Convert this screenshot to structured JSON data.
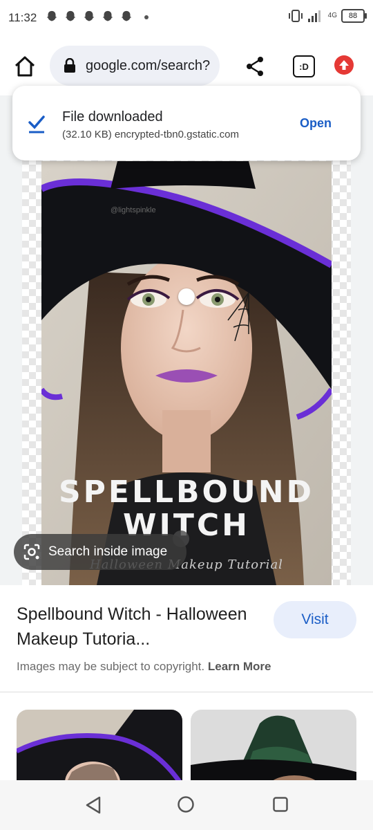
{
  "status_bar": {
    "time": "11:32",
    "notification_icons": [
      "snapchat-icon",
      "snapchat-icon",
      "snapchat-icon",
      "snapchat-icon",
      "snapchat-icon"
    ],
    "network": "4G",
    "battery": "88"
  },
  "toolbar": {
    "url": "google.com/search?",
    "tab_switcher_label": ":D",
    "icons": [
      "home-icon",
      "lock-icon",
      "share-icon",
      "tab-switcher-icon",
      "update-icon"
    ]
  },
  "download": {
    "title": "File downloaded",
    "subtitle": "(32.10 KB) encrypted-tbn0.gstatic.com",
    "action": "Open"
  },
  "image": {
    "title_line1": "SPELLBOUND",
    "title_line2": "WITCH",
    "subtitle": "Halloween Makeup Tutorial",
    "watermark": "@lightspinkle"
  },
  "lens": {
    "label": "Search inside image"
  },
  "result": {
    "title": "Spellbound Witch - Halloween Makeup Tutoria...",
    "visit_label": "Visit",
    "copyright_text": "Images may be subject to copyright.",
    "learn_more": "Learn More"
  },
  "colors": {
    "accent_blue": "#1a5dc6",
    "visit_bg": "#e8eefb",
    "hat_purple": "#6a2fd6",
    "update_red": "#e53935"
  }
}
